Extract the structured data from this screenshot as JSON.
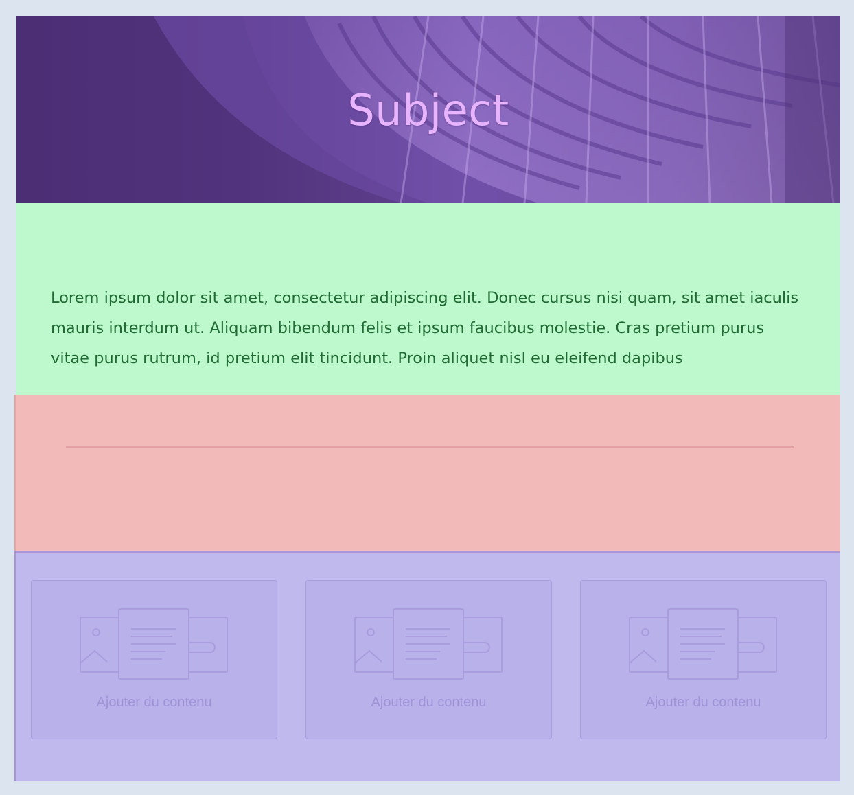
{
  "header": {
    "title": "Subject"
  },
  "text_section": {
    "paragraph": "Lorem ipsum dolor sit amet, consectetur adipiscing elit. Donec cursus nisi quam, sit amet iaculis mauris interdum ut. Aliquam bibendum felis et ipsum faucibus molestie. Cras pretium purus vitae purus rutrum, id pretium elit tincidunt. Proin aliquet nisl eu eleifend dapibus"
  },
  "cards": [
    {
      "label": "Ajouter du contenu",
      "icon": "content-placeholder-icon"
    },
    {
      "label": "Ajouter du contenu",
      "icon": "content-placeholder-icon"
    },
    {
      "label": "Ajouter du contenu",
      "icon": "content-placeholder-icon"
    }
  ],
  "colors": {
    "page_background": "#dce5ef",
    "header_overlay": "#5a3a8a",
    "title_color": "#e8b4ff",
    "text_section_background": "#bef8cd",
    "text_color": "#1f6b33",
    "divider_section_background": "#f2bbba",
    "cards_section_background": "#c0b9ee"
  }
}
